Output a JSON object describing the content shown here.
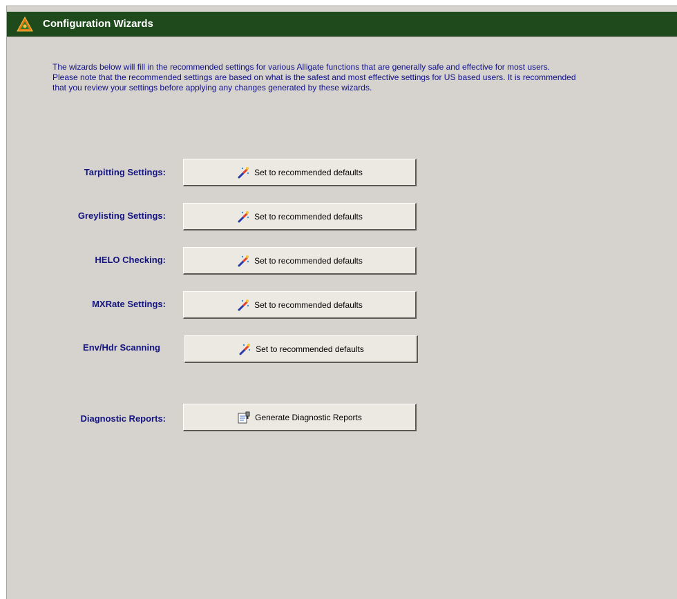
{
  "header": {
    "title": "Configuration Wizards",
    "logo_icon": "alligate-logo-icon"
  },
  "intro_text": "The wizards below will fill in the recommended settings for various Alligate functions that are generally safe and effective for most users. Please note that the recommended settings are based on what is the safest and most effective settings for US based users. It is recommended that you review your settings before applying any changes generated by these wizards.",
  "rows": [
    {
      "label": "Tarpitting Settings:",
      "button_label": "Set to recommended defaults",
      "icon": "magic-wand-icon"
    },
    {
      "label": "Greylisting Settings:",
      "button_label": "Set to recommended defaults",
      "icon": "magic-wand-icon"
    },
    {
      "label": "HELO Checking:",
      "button_label": "Set to recommended defaults",
      "icon": "magic-wand-icon"
    },
    {
      "label": "MXRate Settings:",
      "button_label": "Set to recommended defaults",
      "icon": "magic-wand-icon"
    },
    {
      "label": "Env/Hdr Scanning",
      "button_label": "Set to recommended defaults",
      "icon": "magic-wand-icon"
    },
    {
      "label": "Diagnostic Reports:",
      "button_label": "Generate Diagnostic Reports",
      "icon": "report-icon"
    }
  ],
  "colors": {
    "header_bg": "#1f4a1c",
    "panel_bg": "#d6d3ce",
    "label_text": "#14147f"
  }
}
